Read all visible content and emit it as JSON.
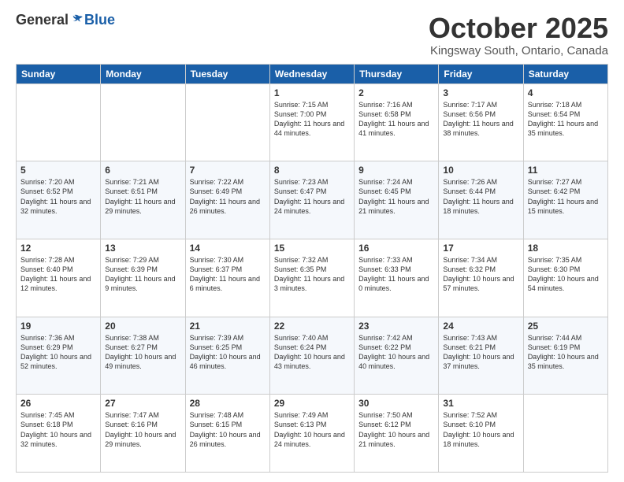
{
  "header": {
    "logo_general": "General",
    "logo_blue": "Blue",
    "month_title": "October 2025",
    "subtitle": "Kingsway South, Ontario, Canada"
  },
  "days_of_week": [
    "Sunday",
    "Monday",
    "Tuesday",
    "Wednesday",
    "Thursday",
    "Friday",
    "Saturday"
  ],
  "weeks": [
    [
      {
        "day": "",
        "info": ""
      },
      {
        "day": "",
        "info": ""
      },
      {
        "day": "",
        "info": ""
      },
      {
        "day": "1",
        "info": "Sunrise: 7:15 AM\nSunset: 7:00 PM\nDaylight: 11 hours\nand 44 minutes."
      },
      {
        "day": "2",
        "info": "Sunrise: 7:16 AM\nSunset: 6:58 PM\nDaylight: 11 hours\nand 41 minutes."
      },
      {
        "day": "3",
        "info": "Sunrise: 7:17 AM\nSunset: 6:56 PM\nDaylight: 11 hours\nand 38 minutes."
      },
      {
        "day": "4",
        "info": "Sunrise: 7:18 AM\nSunset: 6:54 PM\nDaylight: 11 hours\nand 35 minutes."
      }
    ],
    [
      {
        "day": "5",
        "info": "Sunrise: 7:20 AM\nSunset: 6:52 PM\nDaylight: 11 hours\nand 32 minutes."
      },
      {
        "day": "6",
        "info": "Sunrise: 7:21 AM\nSunset: 6:51 PM\nDaylight: 11 hours\nand 29 minutes."
      },
      {
        "day": "7",
        "info": "Sunrise: 7:22 AM\nSunset: 6:49 PM\nDaylight: 11 hours\nand 26 minutes."
      },
      {
        "day": "8",
        "info": "Sunrise: 7:23 AM\nSunset: 6:47 PM\nDaylight: 11 hours\nand 24 minutes."
      },
      {
        "day": "9",
        "info": "Sunrise: 7:24 AM\nSunset: 6:45 PM\nDaylight: 11 hours\nand 21 minutes."
      },
      {
        "day": "10",
        "info": "Sunrise: 7:26 AM\nSunset: 6:44 PM\nDaylight: 11 hours\nand 18 minutes."
      },
      {
        "day": "11",
        "info": "Sunrise: 7:27 AM\nSunset: 6:42 PM\nDaylight: 11 hours\nand 15 minutes."
      }
    ],
    [
      {
        "day": "12",
        "info": "Sunrise: 7:28 AM\nSunset: 6:40 PM\nDaylight: 11 hours\nand 12 minutes."
      },
      {
        "day": "13",
        "info": "Sunrise: 7:29 AM\nSunset: 6:39 PM\nDaylight: 11 hours\nand 9 minutes."
      },
      {
        "day": "14",
        "info": "Sunrise: 7:30 AM\nSunset: 6:37 PM\nDaylight: 11 hours\nand 6 minutes."
      },
      {
        "day": "15",
        "info": "Sunrise: 7:32 AM\nSunset: 6:35 PM\nDaylight: 11 hours\nand 3 minutes."
      },
      {
        "day": "16",
        "info": "Sunrise: 7:33 AM\nSunset: 6:33 PM\nDaylight: 11 hours\nand 0 minutes."
      },
      {
        "day": "17",
        "info": "Sunrise: 7:34 AM\nSunset: 6:32 PM\nDaylight: 10 hours\nand 57 minutes."
      },
      {
        "day": "18",
        "info": "Sunrise: 7:35 AM\nSunset: 6:30 PM\nDaylight: 10 hours\nand 54 minutes."
      }
    ],
    [
      {
        "day": "19",
        "info": "Sunrise: 7:36 AM\nSunset: 6:29 PM\nDaylight: 10 hours\nand 52 minutes."
      },
      {
        "day": "20",
        "info": "Sunrise: 7:38 AM\nSunset: 6:27 PM\nDaylight: 10 hours\nand 49 minutes."
      },
      {
        "day": "21",
        "info": "Sunrise: 7:39 AM\nSunset: 6:25 PM\nDaylight: 10 hours\nand 46 minutes."
      },
      {
        "day": "22",
        "info": "Sunrise: 7:40 AM\nSunset: 6:24 PM\nDaylight: 10 hours\nand 43 minutes."
      },
      {
        "day": "23",
        "info": "Sunrise: 7:42 AM\nSunset: 6:22 PM\nDaylight: 10 hours\nand 40 minutes."
      },
      {
        "day": "24",
        "info": "Sunrise: 7:43 AM\nSunset: 6:21 PM\nDaylight: 10 hours\nand 37 minutes."
      },
      {
        "day": "25",
        "info": "Sunrise: 7:44 AM\nSunset: 6:19 PM\nDaylight: 10 hours\nand 35 minutes."
      }
    ],
    [
      {
        "day": "26",
        "info": "Sunrise: 7:45 AM\nSunset: 6:18 PM\nDaylight: 10 hours\nand 32 minutes."
      },
      {
        "day": "27",
        "info": "Sunrise: 7:47 AM\nSunset: 6:16 PM\nDaylight: 10 hours\nand 29 minutes."
      },
      {
        "day": "28",
        "info": "Sunrise: 7:48 AM\nSunset: 6:15 PM\nDaylight: 10 hours\nand 26 minutes."
      },
      {
        "day": "29",
        "info": "Sunrise: 7:49 AM\nSunset: 6:13 PM\nDaylight: 10 hours\nand 24 minutes."
      },
      {
        "day": "30",
        "info": "Sunrise: 7:50 AM\nSunset: 6:12 PM\nDaylight: 10 hours\nand 21 minutes."
      },
      {
        "day": "31",
        "info": "Sunrise: 7:52 AM\nSunset: 6:10 PM\nDaylight: 10 hours\nand 18 minutes."
      },
      {
        "day": "",
        "info": ""
      }
    ]
  ]
}
